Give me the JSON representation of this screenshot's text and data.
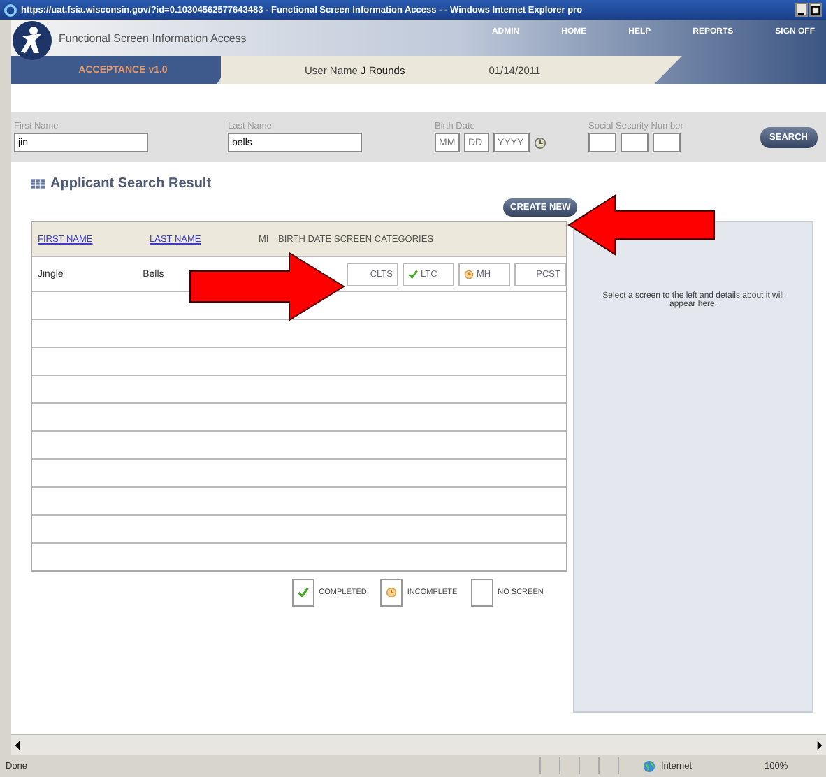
{
  "browser": {
    "title": "https://uat.fsia.wisconsin.gov/?id=0.10304562577643483 - Functional Screen Information Access - - Windows Internet Explorer pro"
  },
  "header": {
    "app_name": "Functional Screen Information Access",
    "nav": [
      "ADMIN",
      "HOME",
      "HELP",
      "REPORTS",
      "SIGN OFF"
    ],
    "environment": "ACCEPTANCE v1.0",
    "user_label": "User Name",
    "user_name": "J Rounds",
    "date": "01/14/2011"
  },
  "search": {
    "first_name": {
      "label": "First Name",
      "value": "jin"
    },
    "last_name": {
      "label": "Last Name",
      "value": "bells"
    },
    "birth_date": {
      "label": "Birth Date",
      "placeholders": [
        "MM",
        "DD",
        "YYYY"
      ]
    },
    "ssn": {
      "label": "Social Security Number"
    },
    "button": "SEARCH"
  },
  "results": {
    "title": "Applicant Search Result",
    "create_button": "CREATE NEW",
    "columns": [
      {
        "label": "FIRST NAME",
        "sortable": true
      },
      {
        "label": "LAST NAME",
        "sortable": true
      },
      {
        "label": "MI",
        "sortable": false
      },
      {
        "label": "BIRTH DATE",
        "sortable": false
      },
      {
        "label": "SCREEN CATEGORIES",
        "sortable": false
      }
    ],
    "rows": [
      {
        "first_name": "Jingle",
        "last_name": "Bells",
        "screens": [
          {
            "label": "CLTS",
            "kind": "none"
          },
          {
            "label": "LTC",
            "kind": "completed"
          },
          {
            "label": "MH",
            "kind": "incomplete"
          },
          {
            "label": "PCST",
            "kind": "none"
          }
        ]
      }
    ]
  },
  "details": {
    "message": "Select a screen to the left and details about it will appear here."
  },
  "legend": [
    {
      "kind": "completed",
      "label": "COMPLETED"
    },
    {
      "kind": "incomplete",
      "label": "INCOMPLETE"
    },
    {
      "kind": "none",
      "label": "NO SCREEN"
    }
  ],
  "status_bar": {
    "text": "Done",
    "zone": "Internet",
    "zoom": "100%"
  }
}
